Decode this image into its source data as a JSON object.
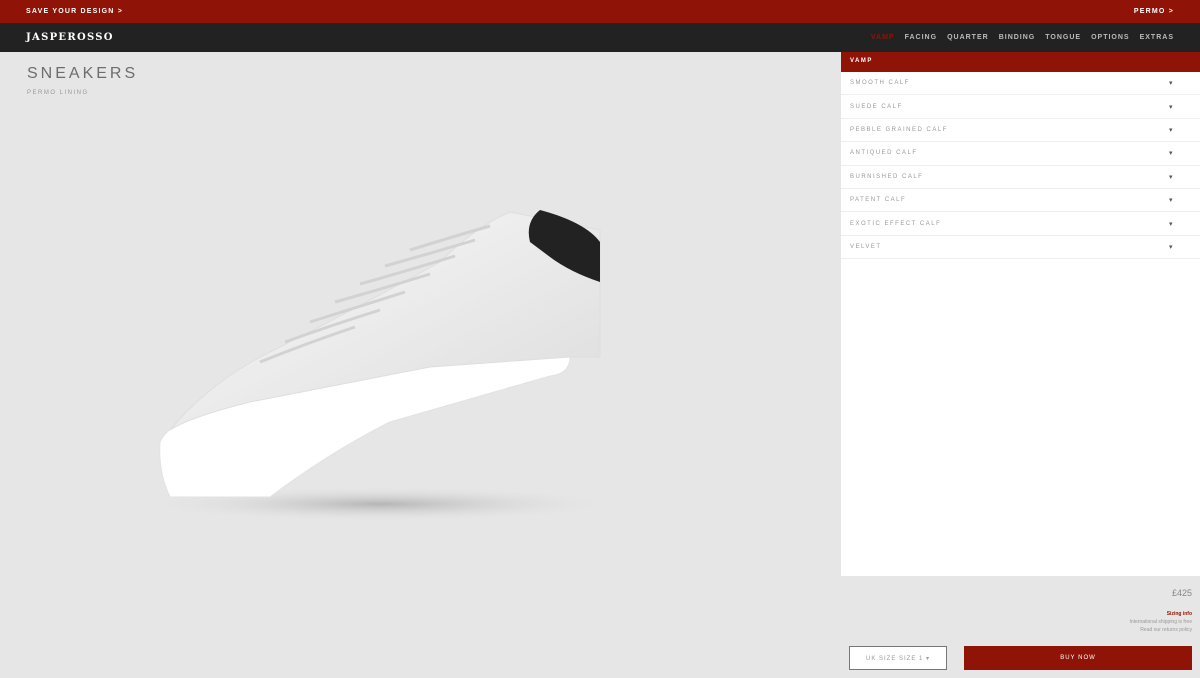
{
  "promo": {
    "left": "SAVE YOUR DESIGN >",
    "right": "PERMO >"
  },
  "nav": {
    "logo": "JASPEROSSO",
    "tabs": [
      {
        "label": "VAMP",
        "active": true
      },
      {
        "label": "FACING"
      },
      {
        "label": "QUARTER"
      },
      {
        "label": "BINDING"
      },
      {
        "label": "TONGUE"
      },
      {
        "label": "OPTIONS"
      },
      {
        "label": "EXTRAS"
      }
    ]
  },
  "stage": {
    "title": "SNEAKERS",
    "subtitle": "PERMO LINING"
  },
  "panel": {
    "header": "VAMP",
    "options": [
      "SMOOTH CALF",
      "SUEDE CALF",
      "PEBBLE GRAINED CALF",
      "ANTIQUED CALF",
      "BURNISHED CALF",
      "PATENT CALF",
      "EXOTIC EFFECT CALF",
      "VELVET"
    ],
    "caret": "▾"
  },
  "footer": {
    "price": "£425",
    "shipping_title": "Sizing info",
    "shipping_line1": "International shipping is free",
    "shipping_line2": "Read our returns policy",
    "size_label": "UK SIZE  SIZE 1 ▾",
    "buy_label": "BUY NOW"
  },
  "colors": {
    "brand": "#8f1306",
    "nav": "#222222",
    "stage": "#e6e6e6"
  }
}
